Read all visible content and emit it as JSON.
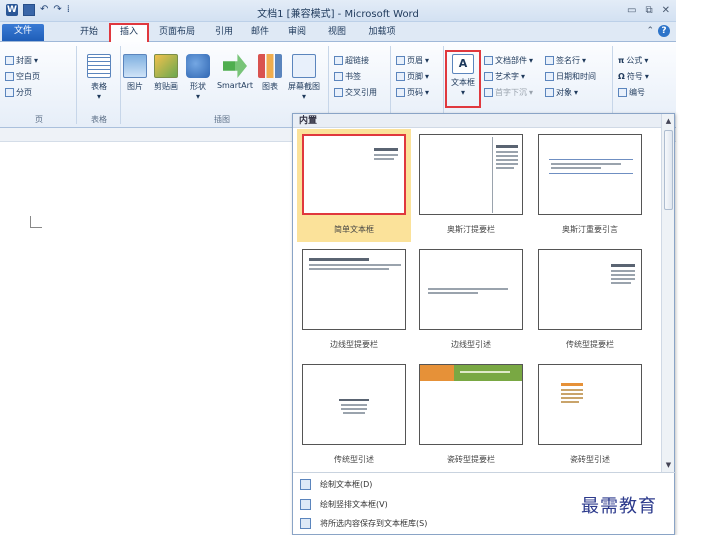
{
  "window": {
    "title": "文档1 [兼容模式] - Microsoft Word",
    "controls": [
      "▭",
      "⧉",
      "✕"
    ]
  },
  "qat": {
    "dropdown": "⁞"
  },
  "tabs": [
    {
      "label": "文件"
    },
    {
      "label": "开始"
    },
    {
      "label": "插入"
    },
    {
      "label": "页面布局"
    },
    {
      "label": "引用"
    },
    {
      "label": "邮件"
    },
    {
      "label": "审阅"
    },
    {
      "label": "视图"
    },
    {
      "label": "加载项"
    }
  ],
  "ribbon": {
    "pages": {
      "label": "页",
      "cover": "封面",
      "blank": "空白页",
      "break": "分页"
    },
    "tables": {
      "label": "表格",
      "table": "表格"
    },
    "illustrations": {
      "label": "插图",
      "picture": "图片",
      "clipart": "剪贴画",
      "shapes": "形状",
      "smartart": "SmartArt",
      "chart": "图表",
      "screenshot": "屏幕截图"
    },
    "links": {
      "hyperlink": "超链接",
      "bookmark": "书签",
      "crossref": "交叉引用"
    },
    "header_footer": {
      "header": "页眉",
      "footer": "页脚",
      "pagenum": "页码"
    },
    "text": {
      "textbox": "文本框",
      "textbox_glyph": "A",
      "quickparts": "文档部件",
      "wordart": "艺术字",
      "dropcap": "首字下沉",
      "signature": "签名行",
      "datetime": "日期和时间",
      "object": "对象"
    },
    "symbols": {
      "equation": "公式",
      "symbol": "符号",
      "number": "编号"
    }
  },
  "gallery": {
    "header": "内置",
    "tiles": [
      {
        "label": "简单文本框"
      },
      {
        "label": "奥斯汀提要栏"
      },
      {
        "label": "奥斯汀重要引言"
      },
      {
        "label": "边线型提要栏"
      },
      {
        "label": "边线型引述"
      },
      {
        "label": "传统型提要栏"
      },
      {
        "label": "传统型引述"
      },
      {
        "label": "瓷砖型提要栏"
      },
      {
        "label": "瓷砖型引述"
      }
    ],
    "menu": [
      {
        "label": "绘制文本框(D)"
      },
      {
        "label": "绘制竖排文本框(V)"
      },
      {
        "label": "将所选内容保存到文本框库(S)"
      }
    ]
  },
  "watermark": "最需教育",
  "colors": {
    "highlight_red": "#e0383e",
    "file_tab_blue": "#1f5eb8",
    "selected_tile": "#fbe29a"
  }
}
